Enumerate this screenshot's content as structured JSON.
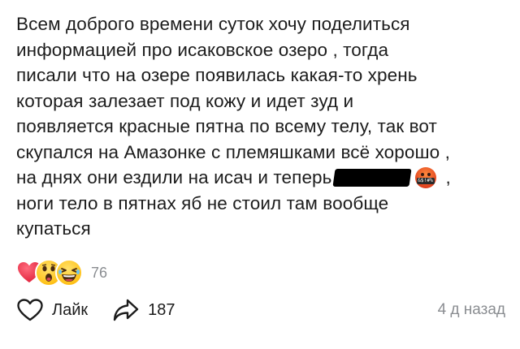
{
  "post": {
    "lines": [
      "Всем доброго времени суток хочу поделиться",
      "информацией про исаковское озеро , тогда",
      "писали что на озере появилась какая-то хрень",
      "которая залезает под кожу и идет зуд и",
      "появляется красные пятна по всему телу, так вот",
      "скупался на Амазонке с племяшками всё хорошо ,",
      "на днях они ездили на исач и теперь",
      "ноги тело в пятнах яб не стоил там вообще",
      "купаться"
    ],
    "line7_suffix": ",",
    "angry_emoji_symbols": "&$!#%"
  },
  "reactions": {
    "emojis": [
      "heart-emoji",
      "wow-emoji",
      "laugh-emoji"
    ],
    "count": "76"
  },
  "actions": {
    "like_label": "Лайк",
    "share_count": "187",
    "timestamp": "4 д назад"
  },
  "colors": {
    "text": "#1c1c1c",
    "muted": "#8a8d91",
    "heart": "#f0374c",
    "emoji_yellow": "#ffc21a"
  },
  "icons": {
    "like": "heart-outline-icon",
    "share": "share-arrow-icon"
  }
}
